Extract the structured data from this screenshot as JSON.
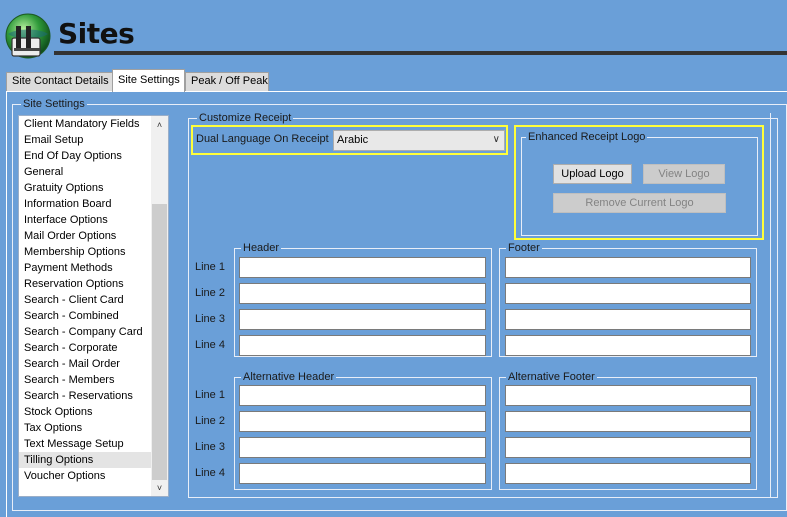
{
  "app": {
    "title": "Sites"
  },
  "tabs": [
    {
      "label": "Site Contact Details"
    },
    {
      "label": "Site Settings"
    },
    {
      "label": "Peak / Off Peak"
    }
  ],
  "settings_group": {
    "title": "Site Settings"
  },
  "settings_list": {
    "items": [
      "Client Mandatory Fields",
      "Email Setup",
      "End Of Day Options",
      "General",
      "Gratuity Options",
      "Information Board",
      "Interface Options",
      "Mail Order Options",
      "Membership Options",
      "Payment Methods",
      "Reservation Options",
      "Search - Client Card",
      "Search - Combined",
      "Search - Company Card",
      "Search - Corporate",
      "Search - Mail Order",
      "Search - Members",
      "Search - Reservations",
      "Stock Options",
      "Tax Options",
      "Text Message Setup",
      "Tilling Options",
      "Voucher Options"
    ],
    "selected": "Tilling Options"
  },
  "customize": {
    "title": "Customize Receipt",
    "dual_language_label": "Dual Language On Receipt",
    "dual_language_value": "Arabic",
    "logo_group": {
      "title": "Enhanced Receipt Logo",
      "upload": "Upload Logo",
      "view": "View Logo",
      "remove": "Remove Current Logo"
    },
    "header": {
      "title": "Header"
    },
    "footer": {
      "title": "Footer"
    },
    "alt_header": {
      "title": "Alternative Header"
    },
    "alt_footer": {
      "title": "Alternative Footer"
    },
    "line_labels": [
      "Line 1",
      "Line 2",
      "Line 3",
      "Line 4"
    ]
  },
  "colors": {
    "background": "#6a9fd8",
    "highlight": "#ffff3a"
  }
}
